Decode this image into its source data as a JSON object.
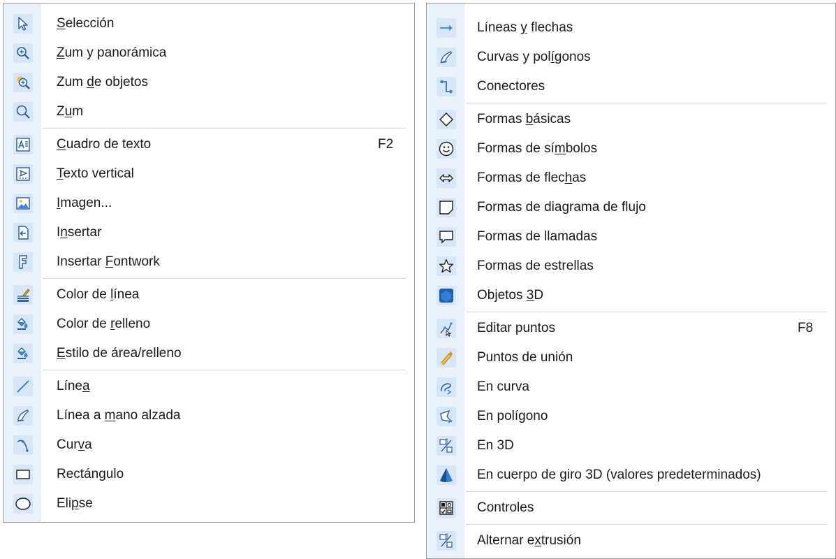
{
  "left_menu": {
    "groups": [
      [
        {
          "pre": "",
          "ul": "S",
          "post": "elección",
          "icon": "arrow-pointer-icon"
        },
        {
          "pre": "",
          "ul": "Z",
          "post": "um y panorámica",
          "icon": "zoom-pan-icon"
        },
        {
          "pre": "Zum ",
          "ul": "d",
          "post": "e objetos",
          "icon": "object-zoom-icon"
        },
        {
          "pre": "Z",
          "ul": "u",
          "post": "m",
          "icon": "magnifier-icon"
        }
      ],
      [
        {
          "pre": "",
          "ul": "C",
          "post": "uadro de texto",
          "icon": "text-box-icon",
          "shortcut": "F2"
        },
        {
          "pre": "",
          "ul": "T",
          "post": "exto vertical",
          "icon": "vertical-text-icon"
        },
        {
          "pre": "",
          "ul": "I",
          "post": "magen...",
          "icon": "image-icon"
        },
        {
          "pre": "I",
          "ul": "n",
          "post": "sertar",
          "icon": "insert-icon"
        },
        {
          "pre": "Insertar ",
          "ul": "F",
          "post": "ontwork",
          "icon": "fontwork-icon"
        }
      ],
      [
        {
          "pre": "Color de ",
          "ul": "l",
          "post": "ínea",
          "icon": "line-color-icon"
        },
        {
          "pre": "Color de ",
          "ul": "r",
          "post": "elleno",
          "icon": "fill-color-icon"
        },
        {
          "pre": "",
          "ul": "E",
          "post": "stilo de área/relleno",
          "icon": "area-style-icon"
        }
      ],
      [
        {
          "pre": "Líne",
          "ul": "a",
          "post": "",
          "icon": "line-icon"
        },
        {
          "pre": "Línea a ",
          "ul": "m",
          "post": "ano alzada",
          "icon": "freeform-line-icon"
        },
        {
          "pre": "Cur",
          "ul": "v",
          "post": "a",
          "icon": "curve-icon"
        },
        {
          "pre": "Rectán",
          "ul": "g",
          "post": "ulo",
          "icon": "rectangle-icon"
        },
        {
          "pre": "Eli",
          "ul": "p",
          "post": "se",
          "icon": "ellipse-icon"
        }
      ]
    ]
  },
  "right_menu": {
    "groups": [
      [
        {
          "pre": "Líneas ",
          "ul": "y",
          "post": " flechas",
          "icon": "line-arrow-icon"
        },
        {
          "pre": "Curvas y pol",
          "ul": "í",
          "post": "gonos",
          "icon": "curves-polygons-icon"
        },
        {
          "pre": "Conectores",
          "ul": "",
          "post": "",
          "icon": "connector-icon"
        }
      ],
      [
        {
          "pre": "Formas ",
          "ul": "b",
          "post": "ásicas",
          "icon": "diamond-icon"
        },
        {
          "pre": "Formas de sí",
          "ul": "m",
          "post": "bolos",
          "icon": "smiley-icon"
        },
        {
          "pre": "Formas de flec",
          "ul": "h",
          "post": "as",
          "icon": "double-arrow-icon"
        },
        {
          "pre": "Formas de diagrama de flu",
          "ul": "j",
          "post": "o",
          "icon": "flowchart-icon"
        },
        {
          "pre": "Formas de llamadas",
          "ul": "",
          "post": "",
          "icon": "callout-icon"
        },
        {
          "pre": "Formas de estrellas",
          "ul": "",
          "post": "",
          "icon": "star-icon"
        },
        {
          "pre": "Objetos ",
          "ul": "3",
          "post": "D",
          "icon": "cube-3d-icon"
        }
      ],
      [
        {
          "pre": "Editar puntos",
          "ul": "",
          "post": "",
          "icon": "edit-points-icon",
          "shortcut": "F8"
        },
        {
          "pre": "Puntos de unión",
          "ul": "",
          "post": "",
          "icon": "glue-points-icon"
        },
        {
          "pre": "En curva",
          "ul": "",
          "post": "",
          "icon": "to-curve-icon"
        },
        {
          "pre": "En polígono",
          "ul": "",
          "post": "",
          "icon": "to-polygon-icon"
        },
        {
          "pre": "En 3D",
          "ul": "",
          "post": "",
          "icon": "to-3d-icon"
        },
        {
          "pre": "En cuerpo de giro 3D (valores predeterminados)",
          "ul": "",
          "post": "",
          "icon": "rotation-body-icon"
        }
      ],
      [
        {
          "pre": "Controles",
          "ul": "",
          "post": "",
          "icon": "controls-icon"
        }
      ],
      [
        {
          "pre": "Alternar e",
          "ul": "x",
          "post": "trusión",
          "icon": "toggle-extrusion-icon"
        }
      ]
    ]
  }
}
